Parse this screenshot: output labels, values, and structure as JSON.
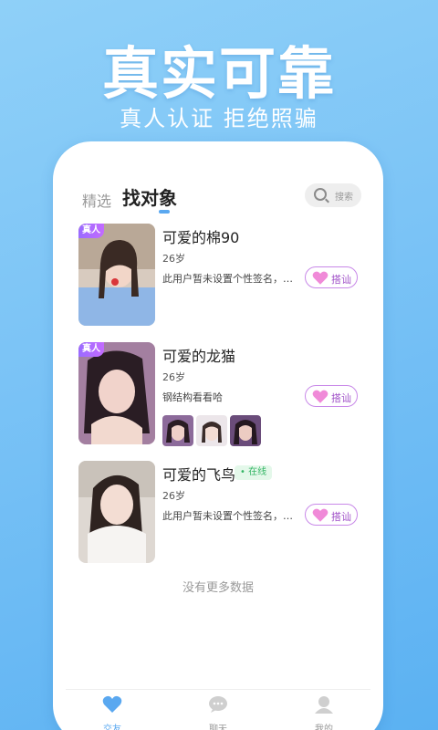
{
  "hero": {
    "title": "真实可靠",
    "subtitle": "真人认证  拒绝照骗"
  },
  "header": {
    "tabs": [
      {
        "label": "精选",
        "active": false
      },
      {
        "label": "找对象",
        "active": true
      }
    ],
    "search": {
      "label": "搜索",
      "icon": "search-icon"
    }
  },
  "users": [
    {
      "name": "可爱的棉90",
      "age": "26岁",
      "signature": "此用户暂未设置个性签名，打招呼",
      "badge": "真人",
      "button": "搭讪",
      "online": ""
    },
    {
      "name": "可爱的龙猫",
      "age": "26岁",
      "signature": "钢结构看看哈",
      "badge": "真人",
      "button": "搭讪",
      "online": ""
    },
    {
      "name": "可爱的飞鸟",
      "age": "26岁",
      "signature": "此用户暂未设置个性签名，打招呼",
      "badge": "",
      "button": "搭讪",
      "online": "• 在线"
    }
  ],
  "footer_text": "没有更多数据",
  "tabbar": {
    "items": [
      {
        "label": "交友",
        "icon": "heart-icon",
        "active": true
      },
      {
        "label": "聊天",
        "icon": "chat-bubble-icon",
        "active": false
      },
      {
        "label": "我的",
        "icon": "profile-icon",
        "active": false
      }
    ]
  },
  "colors": {
    "accent": "#5aa8f0",
    "button_border": "#c888e8",
    "badge": "#9a6bff",
    "online": "#34b565"
  }
}
